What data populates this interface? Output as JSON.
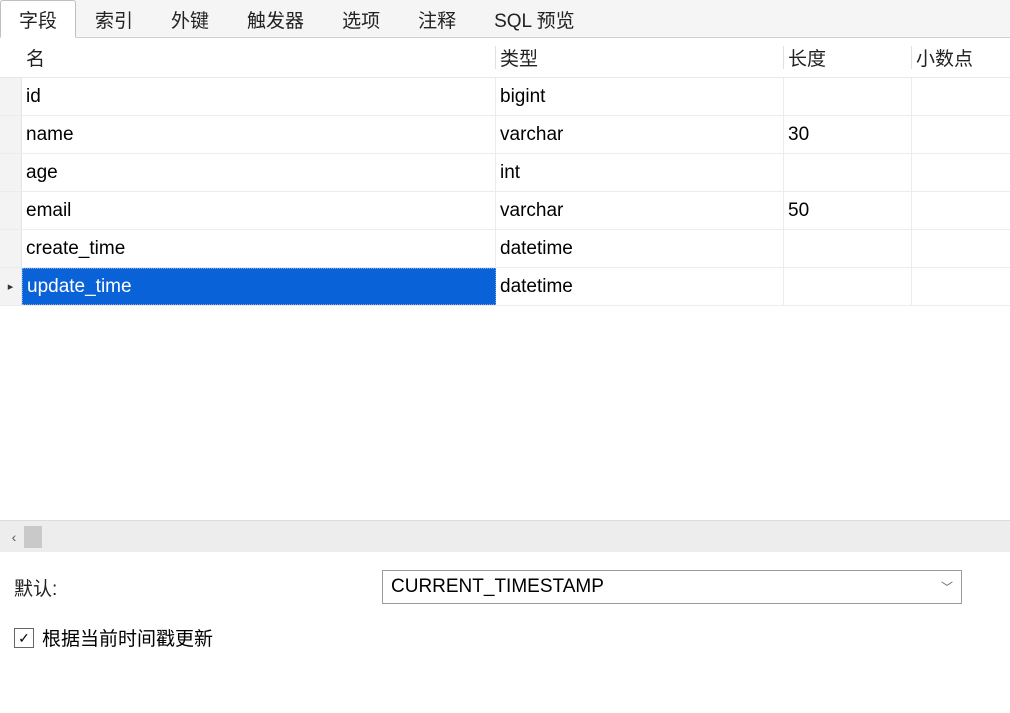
{
  "tabs": {
    "items": [
      {
        "label": "字段",
        "active": true
      },
      {
        "label": "索引",
        "active": false
      },
      {
        "label": "外键",
        "active": false
      },
      {
        "label": "触发器",
        "active": false
      },
      {
        "label": "选项",
        "active": false
      },
      {
        "label": "注释",
        "active": false
      },
      {
        "label": "SQL 预览",
        "active": false
      }
    ]
  },
  "columns": {
    "name": "名",
    "type": "类型",
    "length": "长度",
    "decimal": "小数点"
  },
  "rows": [
    {
      "name": "id",
      "type": "bigint",
      "length": "",
      "decimal": "",
      "selected": false
    },
    {
      "name": "name",
      "type": "varchar",
      "length": "30",
      "decimal": "",
      "selected": false
    },
    {
      "name": "age",
      "type": "int",
      "length": "",
      "decimal": "",
      "selected": false
    },
    {
      "name": "email",
      "type": "varchar",
      "length": "50",
      "decimal": "",
      "selected": false
    },
    {
      "name": "create_time",
      "type": "datetime",
      "length": "",
      "decimal": "",
      "selected": false
    },
    {
      "name": "update_time",
      "type": "datetime",
      "length": "",
      "decimal": "",
      "selected": true
    }
  ],
  "properties": {
    "default_label": "默认:",
    "default_value": "CURRENT_TIMESTAMP",
    "on_update_label": "根据当前时间戳更新",
    "on_update_checked": true
  }
}
